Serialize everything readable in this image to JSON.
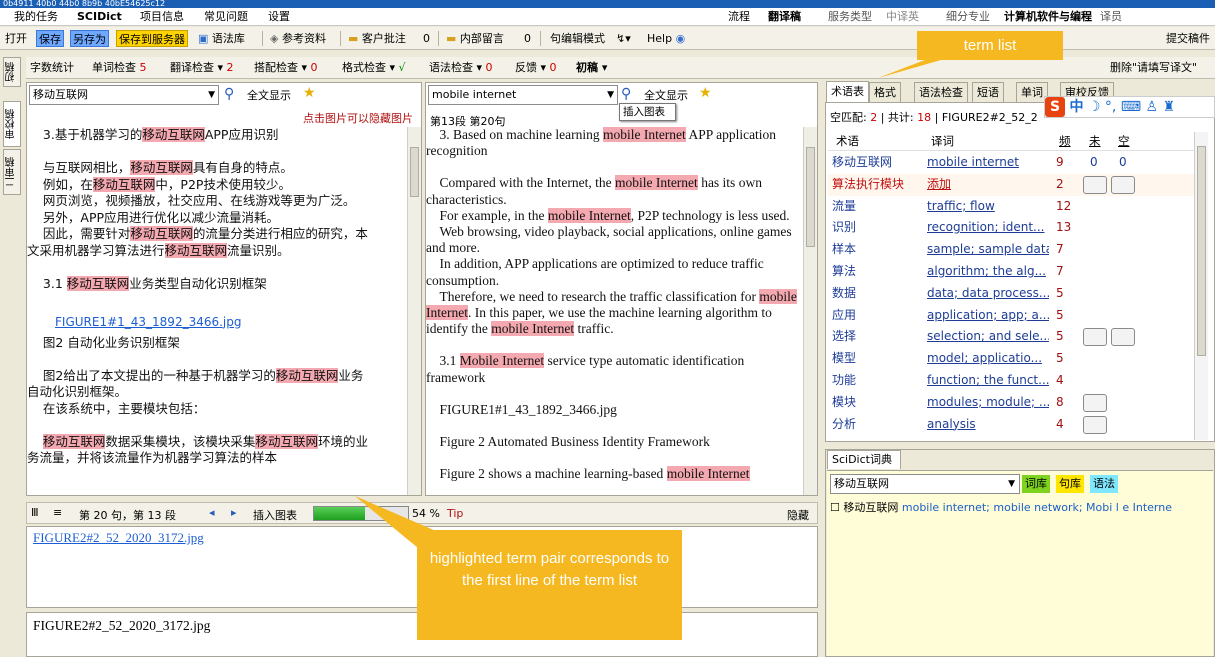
{
  "titlebar": {
    "text": "0b4911 40b0 44b0 8b9b 40bE54625c12"
  },
  "menu": {
    "items": [
      "我的任务",
      "SCIDict",
      "项目信息",
      "常见问题",
      "设置"
    ],
    "right_items": [
      "流程",
      "翻译稿",
      "服务类型",
      "中译英",
      "细分专业",
      "计算机软件与编程",
      "译员"
    ]
  },
  "toolbar": {
    "open": "打开",
    "save": "保存",
    "save_as": "另存为",
    "save_server": "保存到服务器",
    "glossary": "语法库",
    "reference": "参考资料",
    "client_note": "客户批注",
    "client_note_count": "0",
    "internal_msg": "内部留言",
    "internal_msg_count": "0",
    "sentence_mode": "句编辑模式",
    "help": "Help",
    "submit": "提交稿件"
  },
  "side_tabs": [
    "初稿",
    "审校稿",
    "二审稿"
  ],
  "checks": {
    "word_count": "字数统计",
    "word_check": "单词检查",
    "word_check_n": "5",
    "trans_check": "翻译检查",
    "trans_check_n": "2",
    "collocation": "搭配检查",
    "collocation_n": "0",
    "format": "格式检查",
    "format_mark": "√",
    "grammar": "语法检查",
    "grammar_n": "0",
    "feedback": "反馈",
    "feedback_n": "0",
    "first_draft": "初稿",
    "delete_fill": "删除\"请填写译文\""
  },
  "left_pane": {
    "search_value": "移动互联网",
    "show_all": "全文显示",
    "hide_hint": "点击图片可以隐藏图片",
    "lines": [
      {
        "pre": "    3.基于机器学习的",
        "hl": "移动互联网",
        "post": "APP应用识别"
      },
      {
        "pre": "",
        "hl": "",
        "post": ""
      },
      {
        "pre": "    与互联网相比，",
        "hl": "移动互联网",
        "post": "具有自身的特点。"
      },
      {
        "pre": "    例如，在",
        "hl": "移动互联网",
        "post": "中，P2P技术使用较少。"
      },
      {
        "pre": "    网页浏览，视频播放，社交应用、在线游戏等更为广泛。",
        "hl": "",
        "post": ""
      },
      {
        "pre": "    另外，APP应用进行优化以减少流量消耗。",
        "hl": "",
        "post": ""
      },
      {
        "pre": "    因此，需要针对",
        "hl": "移动互联网",
        "post": "的流量分类进行相应的研究，本"
      },
      {
        "pre": "文采用机器学习算法进行",
        "hl": "移动互联网",
        "post": "流量识别。"
      },
      {
        "pre": "",
        "hl": "",
        "post": ""
      },
      {
        "pre": "    3.1 ",
        "hl": "移动互联网",
        "post": "业务类型自动化识别框架"
      },
      {
        "pre": "",
        "hl": "",
        "post": ""
      }
    ],
    "figure_link": "FIGURE1#1_43_1892_3466.jpg",
    "lines2": [
      {
        "pre": "    图2 自动化业务识别框架",
        "hl": "",
        "post": ""
      },
      {
        "pre": "",
        "hl": "",
        "post": ""
      },
      {
        "pre": "    图2给出了本文提出的一种基于机器学习的",
        "hl": "移动互联网",
        "post": "业务"
      },
      {
        "pre": "自动化识别框架。",
        "hl": "",
        "post": ""
      },
      {
        "pre": "    在该系统中，主要模块包括：",
        "hl": "",
        "post": ""
      },
      {
        "pre": "",
        "hl": "",
        "post": ""
      },
      {
        "pre": "    ",
        "hl": "移动互联网",
        "post": "数据采集模块，该模块采集"
      },
      {
        "pre": "务流量，并将该流量作为机器学习算法的样本",
        "hl": "",
        "post": ""
      }
    ],
    "line_last_tail_hl": "移动互联网",
    "line_last_tail": "环境的业"
  },
  "mid_pane": {
    "search_value": "mobile internet",
    "insert_chart": "插入图表",
    "show_all": "全文显示",
    "position": "第13段  第20句",
    "p1_pre": "    3. Based on machine learning ",
    "p1_hl": "mobile Internet",
    "p1_post": " APP application recognition",
    "p2_pre": "    Compared with the Internet, the ",
    "p2_hl": "mobile Internet",
    "p2_post": " has its own characteristics.",
    "p3_pre": "    For example, in the ",
    "p3_hl": "mobile Internet",
    "p3_post": ", P2P technology is less used.",
    "p4": "    Web browsing, video playback, social applications, online games and more.",
    "p5": "    In addition, APP applications are optimized to reduce traffic consumption.",
    "p6_pre": "    Therefore, we need to research the traffic classification for ",
    "p6_hl": "mobile Internet",
    "p6_mid": ". In this paper, we use the machine learning algorithm to identify the ",
    "p6_hl2": "mobile Internet",
    "p6_post": " traffic.",
    "p7_pre": "    3.1 ",
    "p7_hl": "Mobile Internet",
    "p7_post": " service type automatic identification framework",
    "p8": "    FIGURE1#1_43_1892_3466.jpg",
    "p9": "    Figure 2 Automated Business Identity Framework",
    "p10_pre": "    Figure 2 shows a machine learning-based ",
    "p10_hl": "mobile Internet"
  },
  "status_bar": {
    "sentence_info": "第 20 句，第 13 段",
    "insert_chart": "插入图表",
    "progress_pct": 0.54,
    "progress_label": "54 %",
    "tip": "Tip",
    "hide": "隐藏"
  },
  "bottom": {
    "link": "FIGURE2#2_52_2020_3172.jpg",
    "input_text": "FIGURE2#2_52_2020_3172.jpg"
  },
  "right_tabs": [
    "术语表",
    "格式",
    "语法检查",
    "短语",
    "单词",
    "审校反馈"
  ],
  "term_info": {
    "blank_label": "空匹配:",
    "blank_n": "2",
    "total_label": "共计:",
    "total_n": "18",
    "file": "FIGURE2#2_52_2"
  },
  "term_headers": {
    "term": "术语",
    "trans": "译词",
    "freq": "频",
    "undone": "未",
    "empty": "空"
  },
  "terms": [
    {
      "term": "移动互联网",
      "trans": "mobile internet",
      "freq": "9",
      "undone": "0",
      "empty": "0"
    },
    {
      "term": "算法执行模块",
      "trans": "添加",
      "freq": "2",
      "undone": "",
      "empty": ""
    },
    {
      "term": "流量",
      "trans": "traffic; flow",
      "freq": "12",
      "undone": "",
      "empty": ""
    },
    {
      "term": "识别",
      "trans": "recognition; ident...",
      "freq": "13",
      "undone": "",
      "empty": ""
    },
    {
      "term": "样本",
      "trans": "sample; sample data",
      "freq": "7",
      "undone": "",
      "empty": ""
    },
    {
      "term": "算法",
      "trans": "algorithm; the alg...",
      "freq": "7",
      "undone": "",
      "empty": ""
    },
    {
      "term": "数据",
      "trans": "data; data process...",
      "freq": "5",
      "undone": "",
      "empty": ""
    },
    {
      "term": "应用",
      "trans": "application; app; a...",
      "freq": "5",
      "undone": "",
      "empty": ""
    },
    {
      "term": "选择",
      "trans": "selection; and sele...",
      "freq": "5",
      "undone": "",
      "empty": ""
    },
    {
      "term": "模型",
      "trans": "model; applicatio...",
      "freq": "5",
      "undone": "",
      "empty": ""
    },
    {
      "term": "功能",
      "trans": "function; the funct...",
      "freq": "4",
      "undone": "",
      "empty": ""
    },
    {
      "term": "模块",
      "trans": "modules; module; ...",
      "freq": "8",
      "undone": "",
      "empty": ""
    },
    {
      "term": "分析",
      "trans": "analysis",
      "freq": "4",
      "undone": "",
      "empty": ""
    }
  ],
  "dict": {
    "title": "SciDict词典",
    "search_value": "移动互联网",
    "btn_word": "词库",
    "btn_sentence": "句库",
    "btn_grammar": "语法",
    "entry_term": "移动互联网",
    "entry_trans": "mobile internet",
    "entry_rest": "; mobile network; Mobi l e Interne"
  },
  "ime": {
    "logo": "S",
    "label": "中"
  },
  "callouts": {
    "term_list": "term list",
    "highlighted": "highlighted term pair corresponds to the first line of the term list"
  },
  "colors": {
    "highlight": "#f4a8b0",
    "callout": "#f5b820",
    "blue_btn": "#6fa8ff",
    "yellow_btn": "#ffd400"
  }
}
